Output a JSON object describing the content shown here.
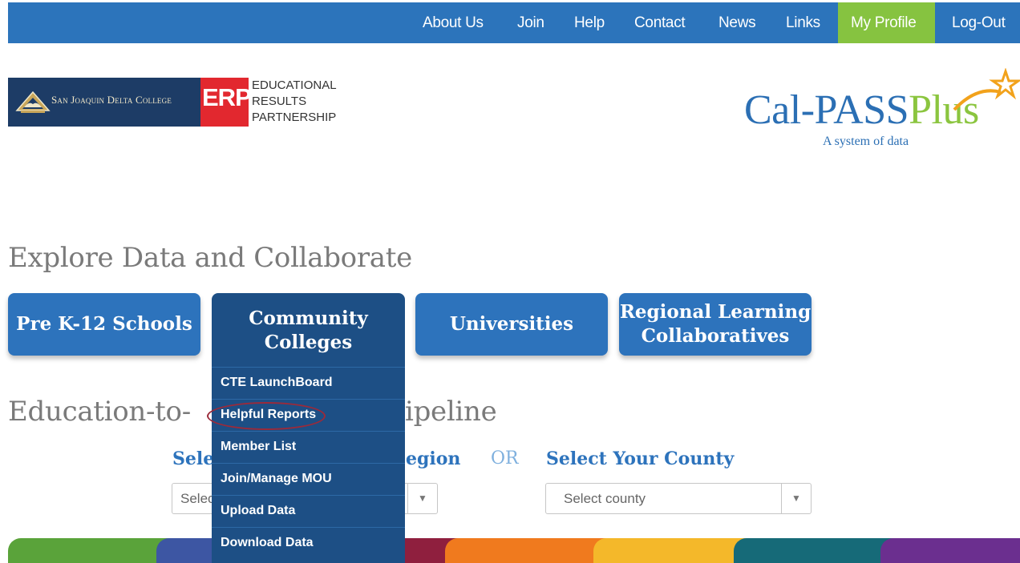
{
  "top_nav": {
    "about": "About Us",
    "join": "Join",
    "help": "Help",
    "contact": "Contact",
    "news": "News",
    "links": "Links",
    "profile": "My Profile",
    "logout": "Log-Out"
  },
  "logos": {
    "sjdc": "San Joaquin Delta College",
    "erp_letters": "ERP",
    "erp_line1": "EDUCATIONAL",
    "erp_line2": "RESULTS",
    "erp_line3": "PARTNERSHIP",
    "calpass_main": "Cal-PASS",
    "calpass_plus": "Plus",
    "calpass_tagline": "A system of data"
  },
  "explore": {
    "heading": "Explore Data and Collaborate",
    "tiles": {
      "prek12": "Pre K-12 Schools",
      "cc_line1": "Community",
      "cc_line2": "Colleges",
      "universities": "Universities",
      "rlc_line1": "Regional Learning",
      "rlc_line2": "Collaboratives"
    }
  },
  "dropdown_menu": {
    "items": [
      "CTE LaunchBoard",
      "Helpful Reports",
      "Member List",
      "Join/Manage MOU",
      "Upload Data",
      "Download Data"
    ]
  },
  "pipeline": {
    "heading_left": "Education-to-",
    "heading_right": "ipeline",
    "select_region_left": "Sele",
    "select_region_right": "egion",
    "or": "OR",
    "select_county": "Select Your County",
    "region_placeholder_partial": "Selec",
    "county_placeholder": "Select county"
  },
  "colors": {
    "nav_blue": "#2c74bb",
    "profile_green": "#86c340",
    "tile_blue": "#2d73bc",
    "menu_dark_blue": "#1d4f85",
    "heading_gray": "#7a7a7a"
  },
  "icons": {
    "sjdc_logo": "delta-college-emblem-icon",
    "calpass_star": "star-swoosh-icon",
    "select_arrow": "caret-down-icon"
  }
}
